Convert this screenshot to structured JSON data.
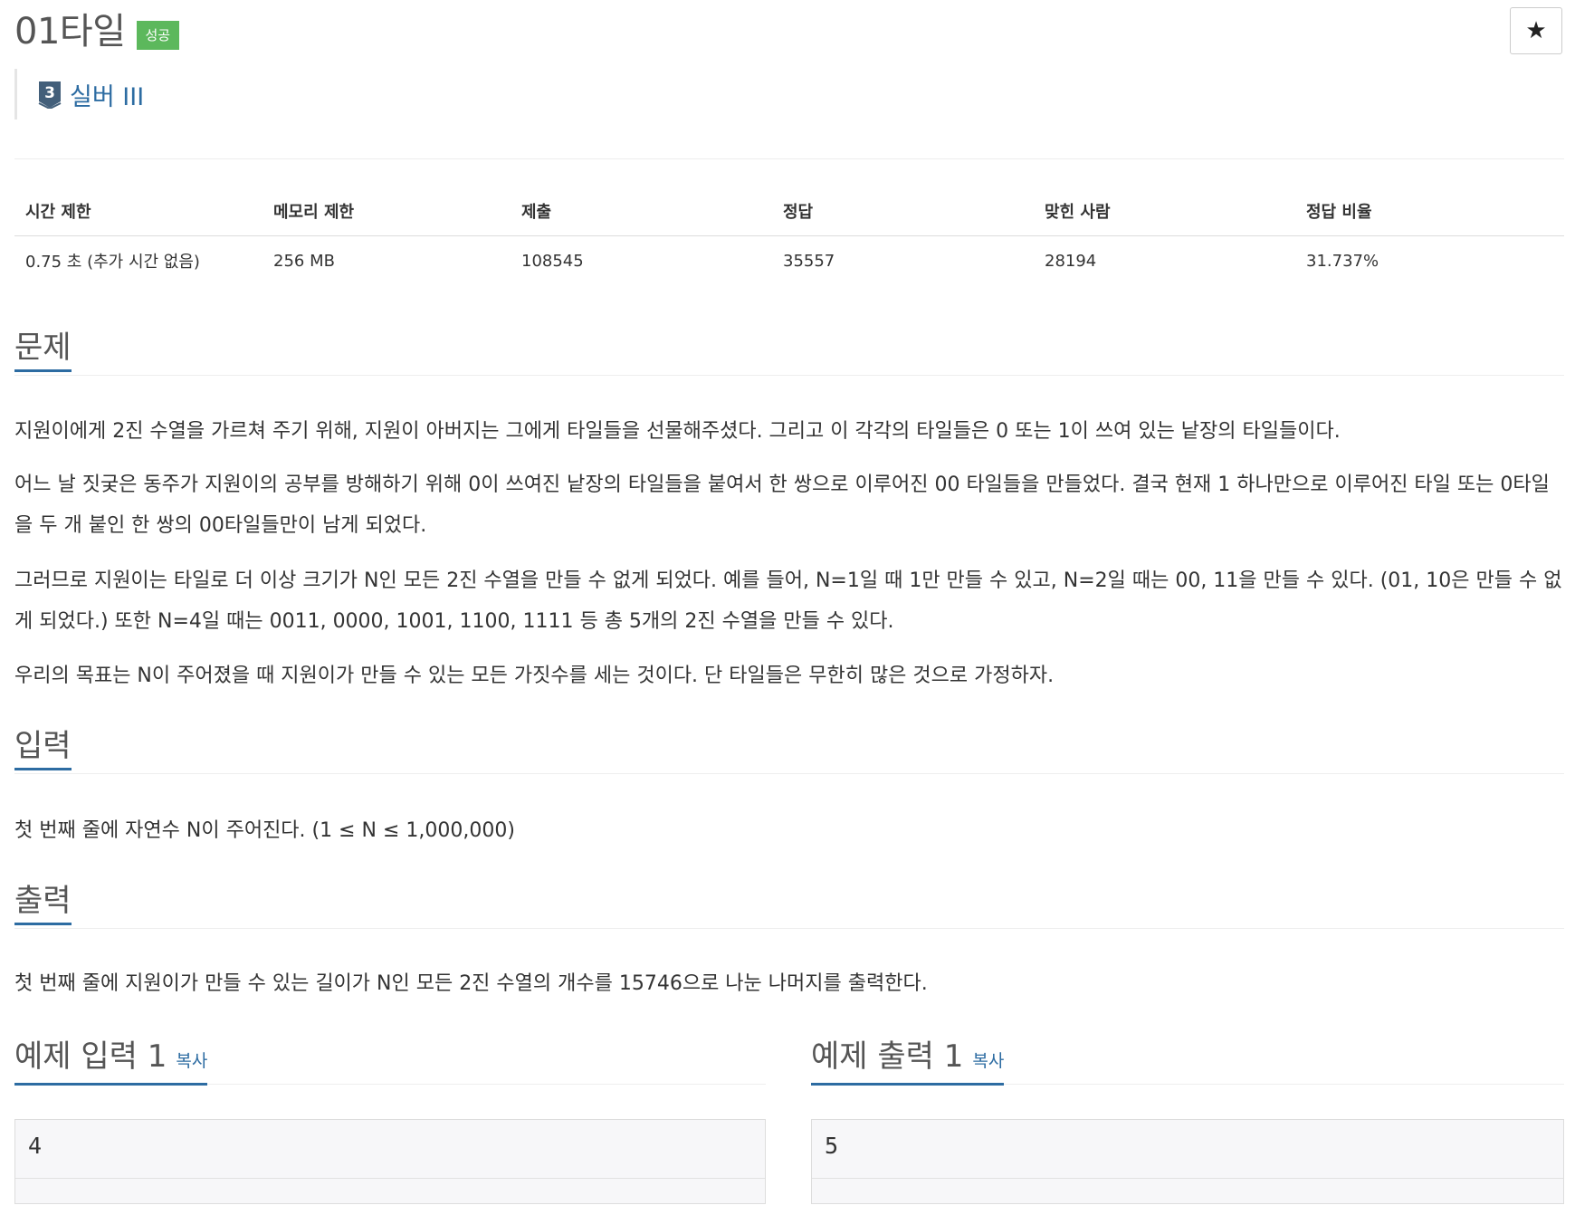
{
  "header": {
    "title": "01타일",
    "status_badge": "성공",
    "star_label": "★",
    "tier_number": "3",
    "tier_label": "실버 III",
    "tier_color": "#2d6ca2"
  },
  "info_table": {
    "headers": [
      "시간 제한",
      "메모리 제한",
      "제출",
      "정답",
      "맞힌 사람",
      "정답 비율"
    ],
    "values": [
      "0.75 초 (추가 시간 없음)",
      "256 MB",
      "108545",
      "35557",
      "28194",
      "31.737%"
    ]
  },
  "problem": {
    "heading": "문제",
    "paragraphs": [
      "지원이에게 2진 수열을 가르쳐 주기 위해, 지원이 아버지는 그에게 타일들을 선물해주셨다. 그리고 이 각각의 타일들은 0 또는 1이 쓰여 있는 낱장의 타일들이다.",
      "어느 날 짓궂은 동주가 지원이의 공부를 방해하기 위해 0이 쓰여진 낱장의 타일들을 붙여서 한 쌍으로 이루어진 00 타일들을 만들었다. 결국 현재 1 하나만으로 이루어진 타일 또는 0타일을 두 개 붙인 한 쌍의 00타일들만이 남게 되었다.",
      "그러므로 지원이는 타일로 더 이상 크기가 N인 모든 2진 수열을 만들 수 없게 되었다. 예를 들어, N=1일 때 1만 만들 수 있고, N=2일 때는 00, 11을 만들 수 있다. (01, 10은 만들 수 없게 되었다.) 또한 N=4일 때는 0011, 0000, 1001, 1100, 1111 등 총 5개의 2진 수열을 만들 수 있다.",
      "우리의 목표는 N이 주어졌을 때 지원이가 만들 수 있는 모든 가짓수를 세는 것이다. 단 타일들은 무한히 많은 것으로 가정하자."
    ]
  },
  "input": {
    "heading": "입력",
    "text": "첫 번째 줄에 자연수 N이 주어진다. (1 ≤ N ≤ 1,000,000)"
  },
  "output": {
    "heading": "출력",
    "text": "첫 번째 줄에 지원이가 만들 수 있는 길이가 N인 모든 2진 수열의 개수를 15746으로 나눈 나머지를 출력한다."
  },
  "samples": {
    "input_heading": "예제 입력 1",
    "output_heading": "예제 출력 1",
    "copy_label": "복사",
    "input_value": "4",
    "output_value": "5"
  },
  "colors": {
    "accent": "#2d6ca2",
    "success": "#5cb85c"
  }
}
